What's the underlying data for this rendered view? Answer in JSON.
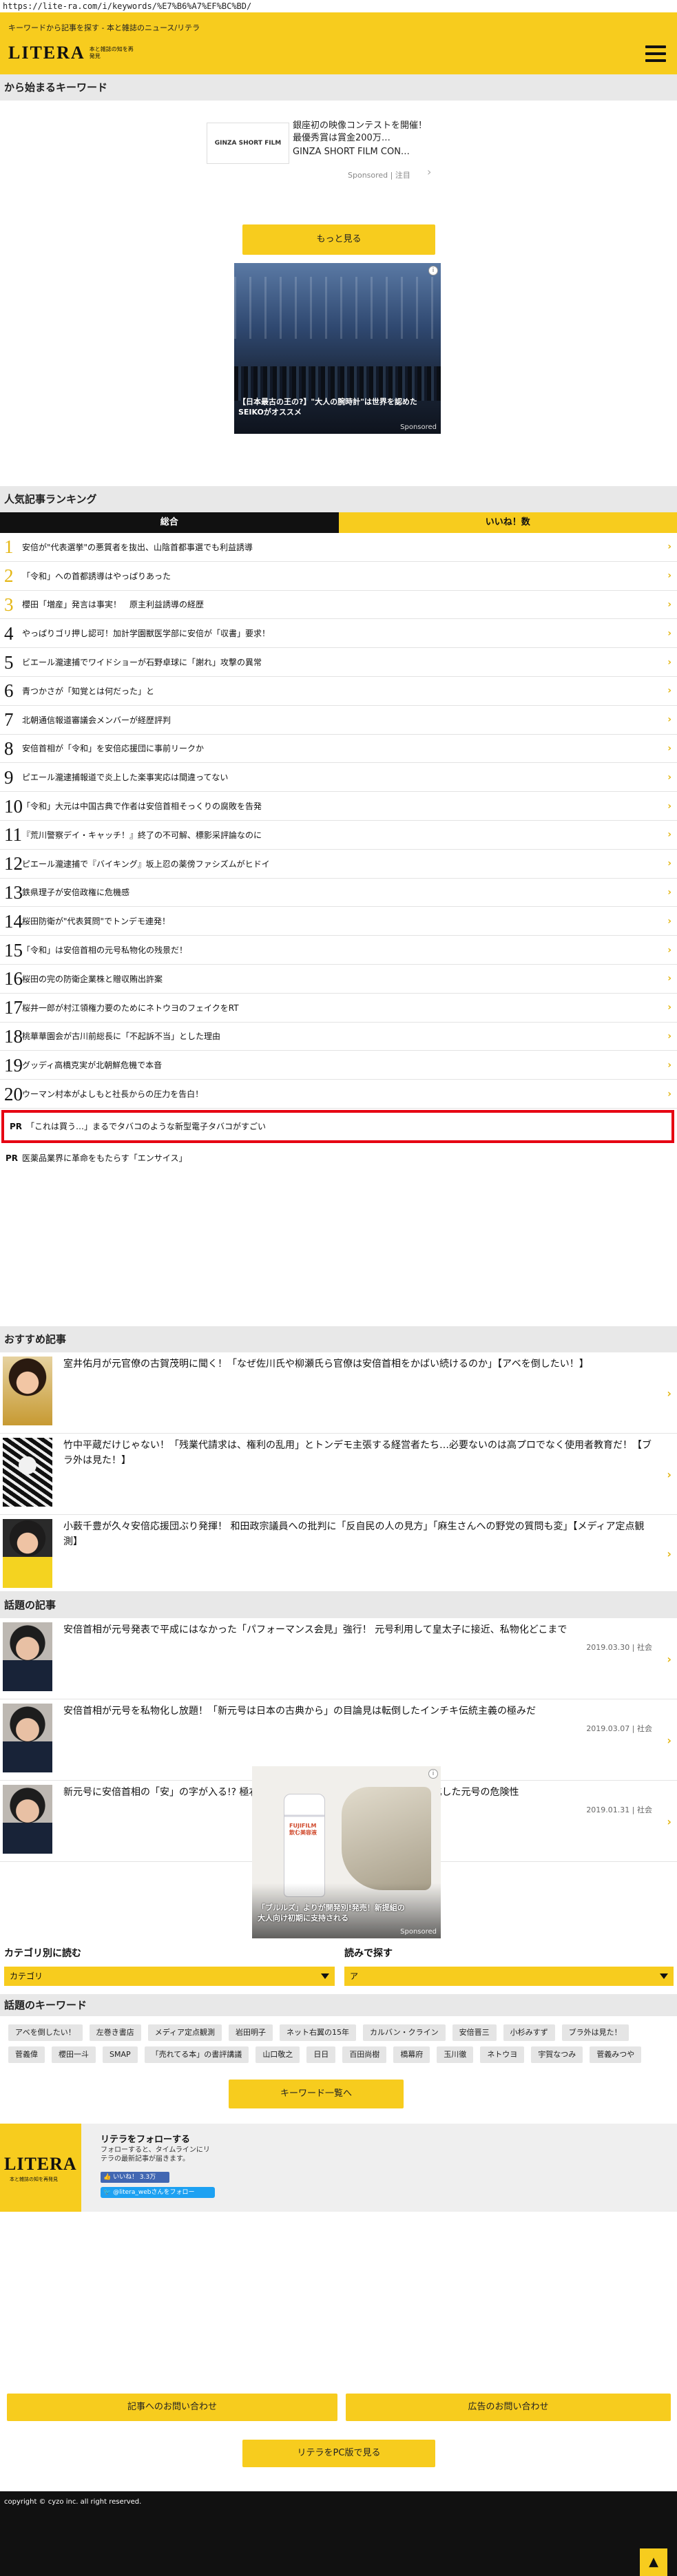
{
  "browser": {
    "url": "https://lite-ra.com/i/keywords/%E7%B6%A7%EF%BC%BD/"
  },
  "header": {
    "tagline": "キーワードから記事を探す - 本と雑誌のニュース/リテラ",
    "logo_text": "LITERA",
    "logo_sub": "本と雑誌の知を再発見"
  },
  "keyword_section": {
    "title": "から始まるキーワード"
  },
  "top_ad": {
    "thumb_label": "GINZA SHORT FILM",
    "text": "銀座初の映像コンテストを開催！最優秀賞は賞金200万…",
    "source": "GINZA SHORT FILM CON…",
    "sponsored": "Sponsored | 注目"
  },
  "more_button": "もっと見る",
  "photo_ad": {
    "caption": "【日本最古の王の?】\"大人の腕時計\"は世界を認めたSEIKOがオススメ",
    "sponsored": "Sponsored"
  },
  "ranking": {
    "title": "人気記事ランキング",
    "tabs": [
      "総合",
      "いいね！数"
    ],
    "items": [
      {
        "num": "1",
        "title": "安倍が\"代表選挙\"の悪質者を抜出、山陰首都事選でも利益誘導"
      },
      {
        "num": "2",
        "title": "「令和」への首都誘導はやっぱりあった"
      },
      {
        "num": "3",
        "title": "櫻田「増産」発言は事実！　原主利益誘導の経歴"
      },
      {
        "num": "4",
        "title": "やっぱりゴリ押し認可！加計学園獣医学部に安倍が「収書」要求！"
      },
      {
        "num": "5",
        "title": "ビエール瀧逮捕でワイドショーが石野卓球に「謝れ」攻撃の異常"
      },
      {
        "num": "6",
        "title": "青つかさが「知覚とは何だった」と"
      },
      {
        "num": "7",
        "title": "北朝通信報道審議会メンバーが経歴評判"
      },
      {
        "num": "8",
        "title": "安倍首相が「令和」を安倍応援団に事前リークか"
      },
      {
        "num": "9",
        "title": "ピエール瀧逮捕報道で炎上した楽事実応は間違ってない"
      },
      {
        "num": "10",
        "title": "「令和」大元は中国古典で作者は安倍首相そっくりの腐敗を告発"
      },
      {
        "num": "11",
        "title": "『荒川警察デイ・キャッチ！』終了の不可解、標影采評論なのに"
      },
      {
        "num": "12",
        "title": "ピエール瀧逮捕で『バイキング』坂上忍の薬傍ファシズムがヒドイ"
      },
      {
        "num": "13",
        "title": "鉄県理子が安倍政権に危機感"
      },
      {
        "num": "14",
        "title": "桜田防衛が\"代表質問\"でトンデモ連発！"
      },
      {
        "num": "15",
        "title": "「令和」は安倍首相の元号私物化の残景だ！"
      },
      {
        "num": "16",
        "title": "桜田の完の防衛企業株と贈収賄出許案"
      },
      {
        "num": "17",
        "title": "桜井一郎が村江領権力要のためにネトウヨのフェイクをRT"
      },
      {
        "num": "18",
        "title": "桃華華園会が古川前総長に「不起訴不当」とした理由"
      },
      {
        "num": "19",
        "title": "グッディ高橋克実が北朝鮮危機で本音"
      },
      {
        "num": "20",
        "title": "ウーマン村本がよしもと社長からの圧力を告白！"
      }
    ],
    "pr_items": [
      {
        "label": "PR",
        "title": "「これは買う…」まるでタバコのような新型電子タバコがすごい"
      },
      {
        "label": "PR",
        "title": "医薬品業界に革命をもたらす「エンサイス」"
      }
    ]
  },
  "recommended": {
    "title": "おすすめ記事",
    "items": [
      {
        "title": "室井佑月が元官僚の古賀茂明に聞く！「なぜ佐川氏や柳瀬氏ら官僚は安倍首相をかばい続けるのか」【アベを倒したい！】"
      },
      {
        "title": "竹中平蔵だけじゃない！「残業代請求は、権利の乱用」とトンデモ主張する経営者たち…必要ないのは高プロでなく使用者教育だ！【ブラ外は見た！】"
      },
      {
        "title": "小薮千豊が久々安倍応援団ぶり発揮！ 和田政宗議員への批判に「反自民の人の見方」「麻生さんへの野党の質問も変」【メディア定点観測】"
      }
    ]
  },
  "topics": {
    "title": "話題の記事",
    "items": [
      {
        "title": "安倍首相が元号発表で平成にはなかった「パフォーマンス会見」強行！ 元号利用して皇太子に接近、私物化どこまで",
        "meta": "2019.03.30 | 社会"
      },
      {
        "title": "安倍首相が元号を私物化し放題！「新元号は日本の古典から」の目論見は転倒したインチキ伝統主義の極みだ",
        "meta": "2019.03.07 | 社会"
      },
      {
        "title": "新元号に安倍首相の「安」の字が入る!? 極右勢力が「国体思想の復活」を目指し法制化した元号の危険性",
        "meta": "2019.01.31 | 社会"
      }
    ]
  },
  "bottom_ad": {
    "bottle_label": "FUJIFILM 飲む美容液",
    "caption": "「ブルルズ」よりが開発別!発売！新提組の大人向け初期に支持される",
    "sponsored": "Sponsored"
  },
  "category": {
    "title": "カテゴリ別に読む",
    "selected": "カテゴリ"
  },
  "syllabary": {
    "title": "読みで探す",
    "selected": "ア"
  },
  "keywords": {
    "title": "話題のキーワード",
    "tags": [
      "アベを倒したい！",
      "左巻き書店",
      "メディア定点観測",
      "岩田明子",
      "ネット右翼の15年",
      "カルバン・クライン",
      "安倍晋三",
      "小杉みすず",
      "ブラ外は見た！",
      "菅義偉",
      "櫻田一斗",
      "SMAP",
      "「売れてる本」の書評講議",
      "山口敬之",
      "日日",
      "百田尚樹",
      "橋幕府",
      "玉川徹",
      "ネトウヨ",
      "宇賀なつみ",
      "菅義みつや"
    ],
    "list_button": "キーワード一覧へ"
  },
  "follow": {
    "logo_text": "LITERA",
    "logo_sub": "本と雑誌の知を再発見",
    "heading": "リテラをフォローする",
    "desc": "フォローすると、タイムラインにリテラの最新記事が届きます。",
    "fb_label": "👍 いいね！ 3.3万",
    "tw_label": "🐦 @litera_webさんをフォロー"
  },
  "contact": {
    "article_inquiry": "記事へのお問い合わせ",
    "ad_inquiry": "広告のお問い合わせ",
    "pc_view": "リテラをPC版で見る"
  },
  "footer": {
    "copyright": "copyright © cyzo inc. all right reserved."
  },
  "colors": {
    "brand": "#f7cc1e",
    "pr_border": "#e60012",
    "dark": "#111111"
  },
  "icons": {
    "menu": "hamburger-icon",
    "chevron": "chevron-right-icon",
    "page_top": "arrow-up-icon",
    "info": "info-icon"
  }
}
